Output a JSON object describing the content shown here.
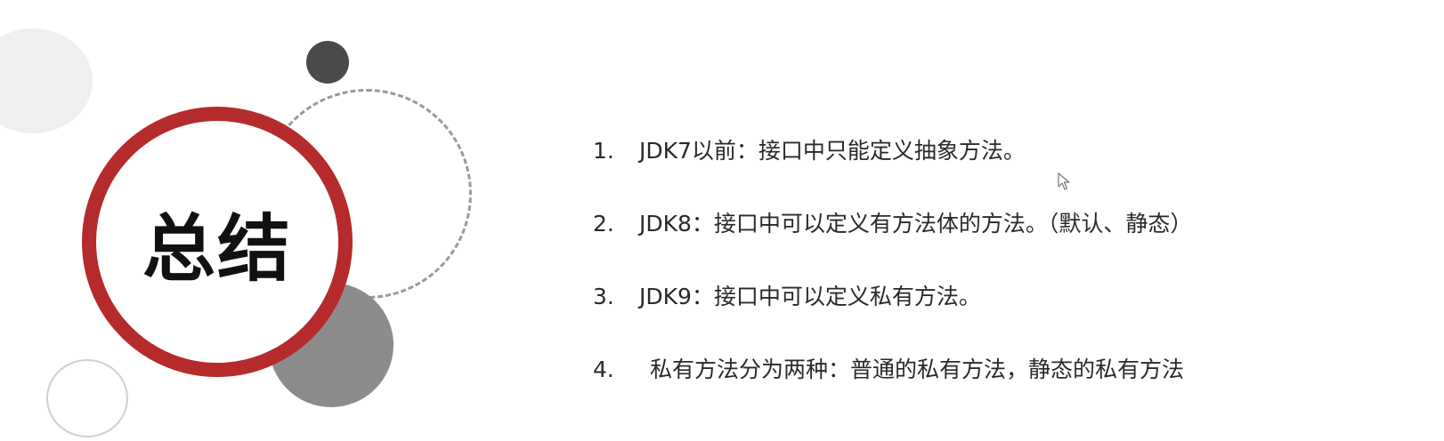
{
  "slide": {
    "title": "总结",
    "items": [
      {
        "number": "1.",
        "text": "JDK7以前：接口中只能定义抽象方法。"
      },
      {
        "number": "2.",
        "text": "JDK8：接口中可以定义有方法体的方法。（默认、静态）"
      },
      {
        "number": "3.",
        "text": "JDK9：接口中可以定义私有方法。"
      },
      {
        "number": "4.",
        "text": "私有方法分为两种：普通的私有方法，静态的私有方法"
      }
    ]
  },
  "colors": {
    "accent_ring": "#b52b2b",
    "dark_circle": "#4a4a4a",
    "gray_circle": "#8c8c8c",
    "light_circle": "#efefef",
    "text": "#2a2a2a"
  },
  "icons": {
    "cursor": "mouse-pointer-icon"
  }
}
